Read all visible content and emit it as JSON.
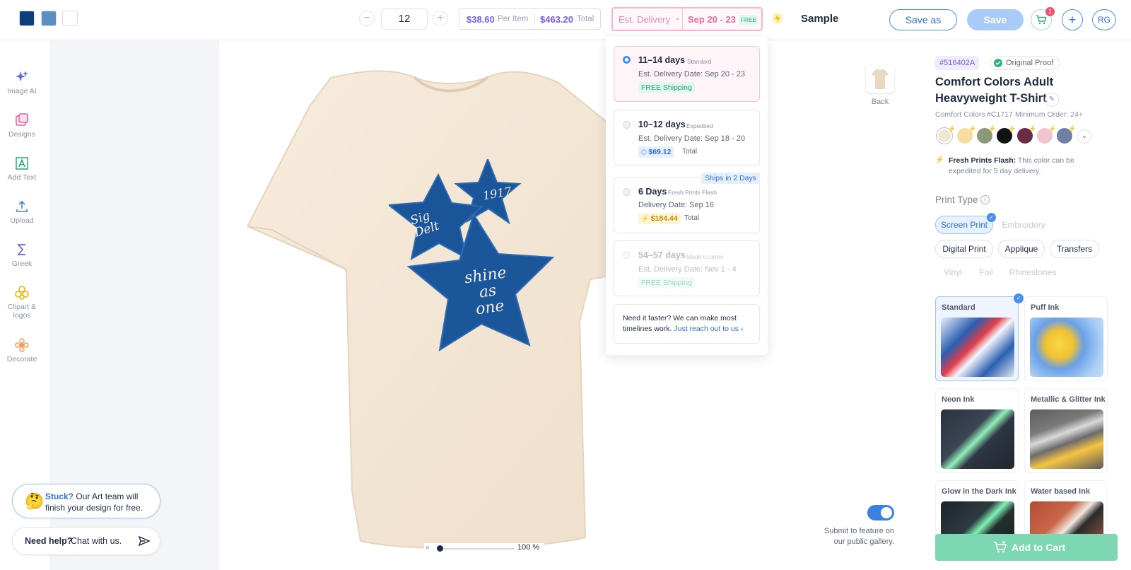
{
  "topbar": {
    "swatch_colors": [
      "#0d3d7a",
      "#5a8fc2",
      "#ffffff"
    ],
    "quantity": "12",
    "qty_minus": "−",
    "qty_plus": "+",
    "per_item_price": "$38.60",
    "per_item_label": "Per Item",
    "total_price": "$463.20",
    "total_label": "Total",
    "est_delivery_label": "Est. Delivery",
    "est_delivery_dates": "Sep 20 - 23",
    "free_badge": "FREE",
    "design_name": "Sample",
    "save_as_label": "Save as",
    "save_label": "Save",
    "cart_count": "1",
    "plus_label": "+",
    "user_initials": "RG"
  },
  "leftnav": [
    {
      "label": "Image AI",
      "icon": "sparkle-icon"
    },
    {
      "label": "Designs",
      "icon": "designs-icon"
    },
    {
      "label": "Add Text",
      "icon": "text-icon"
    },
    {
      "label": "Upload",
      "icon": "upload-icon"
    },
    {
      "label": "Greek",
      "icon": "sigma-icon"
    },
    {
      "label": "Clipart &\nlogos",
      "icon": "clipart-icon"
    },
    {
      "label": "Decorate",
      "icon": "decorate-icon"
    }
  ],
  "delivery_options": [
    {
      "days": "11–14 days",
      "type": "Standard",
      "date": "Est. Delivery Date: Sep 20 - 23",
      "tag": "FREE Shipping",
      "selected": true
    },
    {
      "days": "10–12 days",
      "type": "Expedited",
      "date": "Est. Delivery Date: Sep 18 - 20",
      "price": "$69.12",
      "price_label": "Total"
    },
    {
      "days": "6 Days",
      "type": "Fresh Prints Flash",
      "date": "Delivery Date: Sep 16",
      "price": "$184.44",
      "price_label": "Total",
      "ribbon": "Ships in 2 Days"
    },
    {
      "days": "54–57 days",
      "type": "Made to order",
      "date": "Est. Delivery Date: Nov 1 - 4",
      "tag": "FREE Shipping",
      "disabled": true
    }
  ],
  "delivery_footer": {
    "text": "Need it faster? We can make most timelines work.",
    "link": "Just reach out to us ›"
  },
  "canvas": {
    "design_texts": [
      "Sig\nDelt",
      "1917",
      "shine\nas\none"
    ],
    "back_label": "Back",
    "zoom": "100 %",
    "gallery_text": "Submit to feature on our public gallery."
  },
  "help": {
    "stuck_bold": "Stuck?",
    "stuck_text": "Our Art team will finish your design for free.",
    "chat_bold": "Need help?",
    "chat_text": "Chat with us."
  },
  "product": {
    "proof_id": "#516402A",
    "proof_label": "Original Proof",
    "title": "Comfort Colors Adult Heavyweight T-Shirt",
    "brand": "Comfort Colors",
    "sku": "#C1717",
    "min_order": "Minimum Order: 24+",
    "colors": [
      "#f1e6d4",
      "#f5dea0",
      "#8a9a78",
      "#111111",
      "#6a2a48",
      "#f2c4cf",
      "#6f80a6"
    ],
    "flash_bold": "Fresh Prints Flash:",
    "flash_text": "This color can be expedited for 5 day delivery.",
    "print_type_label": "Print Type",
    "print_types": [
      {
        "label": "Screen Print",
        "state": "active"
      },
      {
        "label": "Embroidery",
        "state": "dim"
      },
      {
        "label": "Digital Print",
        "state": ""
      },
      {
        "label": "Applique",
        "state": ""
      },
      {
        "label": "Transfers",
        "state": ""
      },
      {
        "label": "Vinyl",
        "state": "dim"
      },
      {
        "label": "Foil",
        "state": "dim"
      },
      {
        "label": "Rhinestones",
        "state": "dim"
      }
    ],
    "ink_types": [
      "Standard",
      "Puff Ink",
      "Neon Ink",
      "Metallic & Glitter Ink",
      "Glow in the Dark Ink",
      "Water based Ink"
    ],
    "add_to_cart": "Add to Cart"
  }
}
